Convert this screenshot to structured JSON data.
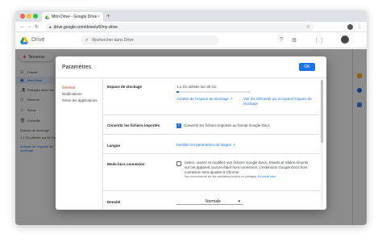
{
  "browser": {
    "tab_title": "Mon Drive - Google Drive",
    "tab_close": "×",
    "new_tab": "+",
    "url": "drive.google.com/drive/u/0/my-drive",
    "back": "←",
    "forward": "→",
    "reload": "↻",
    "bookmark_star": "☆",
    "menu": "⋮"
  },
  "drive": {
    "name": "Drive",
    "search_placeholder": "Rechercher dans Drive",
    "new_button": "Nouveau",
    "sidebar": [
      {
        "label": "Priorité",
        "icon": "priority-icon"
      },
      {
        "label": "Mon Drive",
        "icon": "my-drive-icon",
        "active": true
      },
      {
        "label": "Partagés avec moi",
        "icon": "shared-icon"
      },
      {
        "label": "Récents",
        "icon": "recent-icon"
      },
      {
        "label": "Suivis",
        "icon": "starred-icon"
      },
      {
        "label": "Corbeille",
        "icon": "trash-icon"
      }
    ],
    "storage_label": "Espace de stockage",
    "storage_used": "1,1 Go utilisés sur 30 Go",
    "storage_link": "Acheter de l'espace de stockage"
  },
  "dialog": {
    "title": "Paramètres",
    "ok_label": "OK",
    "nav": [
      "Général",
      "Notifications",
      "Gérer les applications"
    ],
    "storage": {
      "label": "Espace de stockage",
      "used": "1,1 Go utilisés sur 30 Go",
      "used_fraction": 0.037,
      "buy_link": "Acheter de l'espace de stockage ↗",
      "view_link": "Voir les éléments qui occupent l'espace de stockage"
    },
    "convert": {
      "label": "Convertir les fichiers importés",
      "option": "Convertir les fichiers importés au format Google Docs",
      "checked": true
    },
    "language": {
      "label": "Langue",
      "link": "Modifier les paramètres de langue ↗"
    },
    "offline": {
      "label": "Mode hors connexion",
      "text": "Créez, ouvrez et modifiez vos fichiers Google Docs, Sheets et Slides récents sur cet appareil, tout en étant hors connexion. L'extension Google Docs hors connexion sera ajoutée à Chrome",
      "note": "Non recommandé sur les ordinateurs publics ou partagés.",
      "note_link": "En savoir plus",
      "checked": false
    },
    "density": {
      "label": "Densité",
      "value": "Normale",
      "caret": "▾"
    }
  }
}
